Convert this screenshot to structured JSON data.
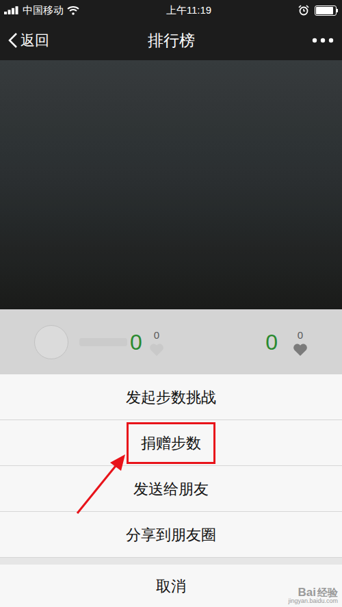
{
  "status_bar": {
    "carrier": "中国移动",
    "time": "上午11:19",
    "battery_level": 0.9
  },
  "nav": {
    "back": "返回",
    "title": "排行榜"
  },
  "ranking_row": {
    "steps": "0",
    "likes": "0",
    "right_steps": "0",
    "right_likes": "0"
  },
  "action_sheet": {
    "items": [
      {
        "label": "发起步数挑战",
        "highlighted": false
      },
      {
        "label": "捐赠步数",
        "highlighted": true
      },
      {
        "label": "发送给朋友",
        "highlighted": false
      },
      {
        "label": "分享到朋友圈",
        "highlighted": false
      }
    ],
    "cancel": "取消"
  },
  "watermark": {
    "brand": "Bai",
    "product": "经验",
    "url": "jingyan.baidu.com"
  }
}
